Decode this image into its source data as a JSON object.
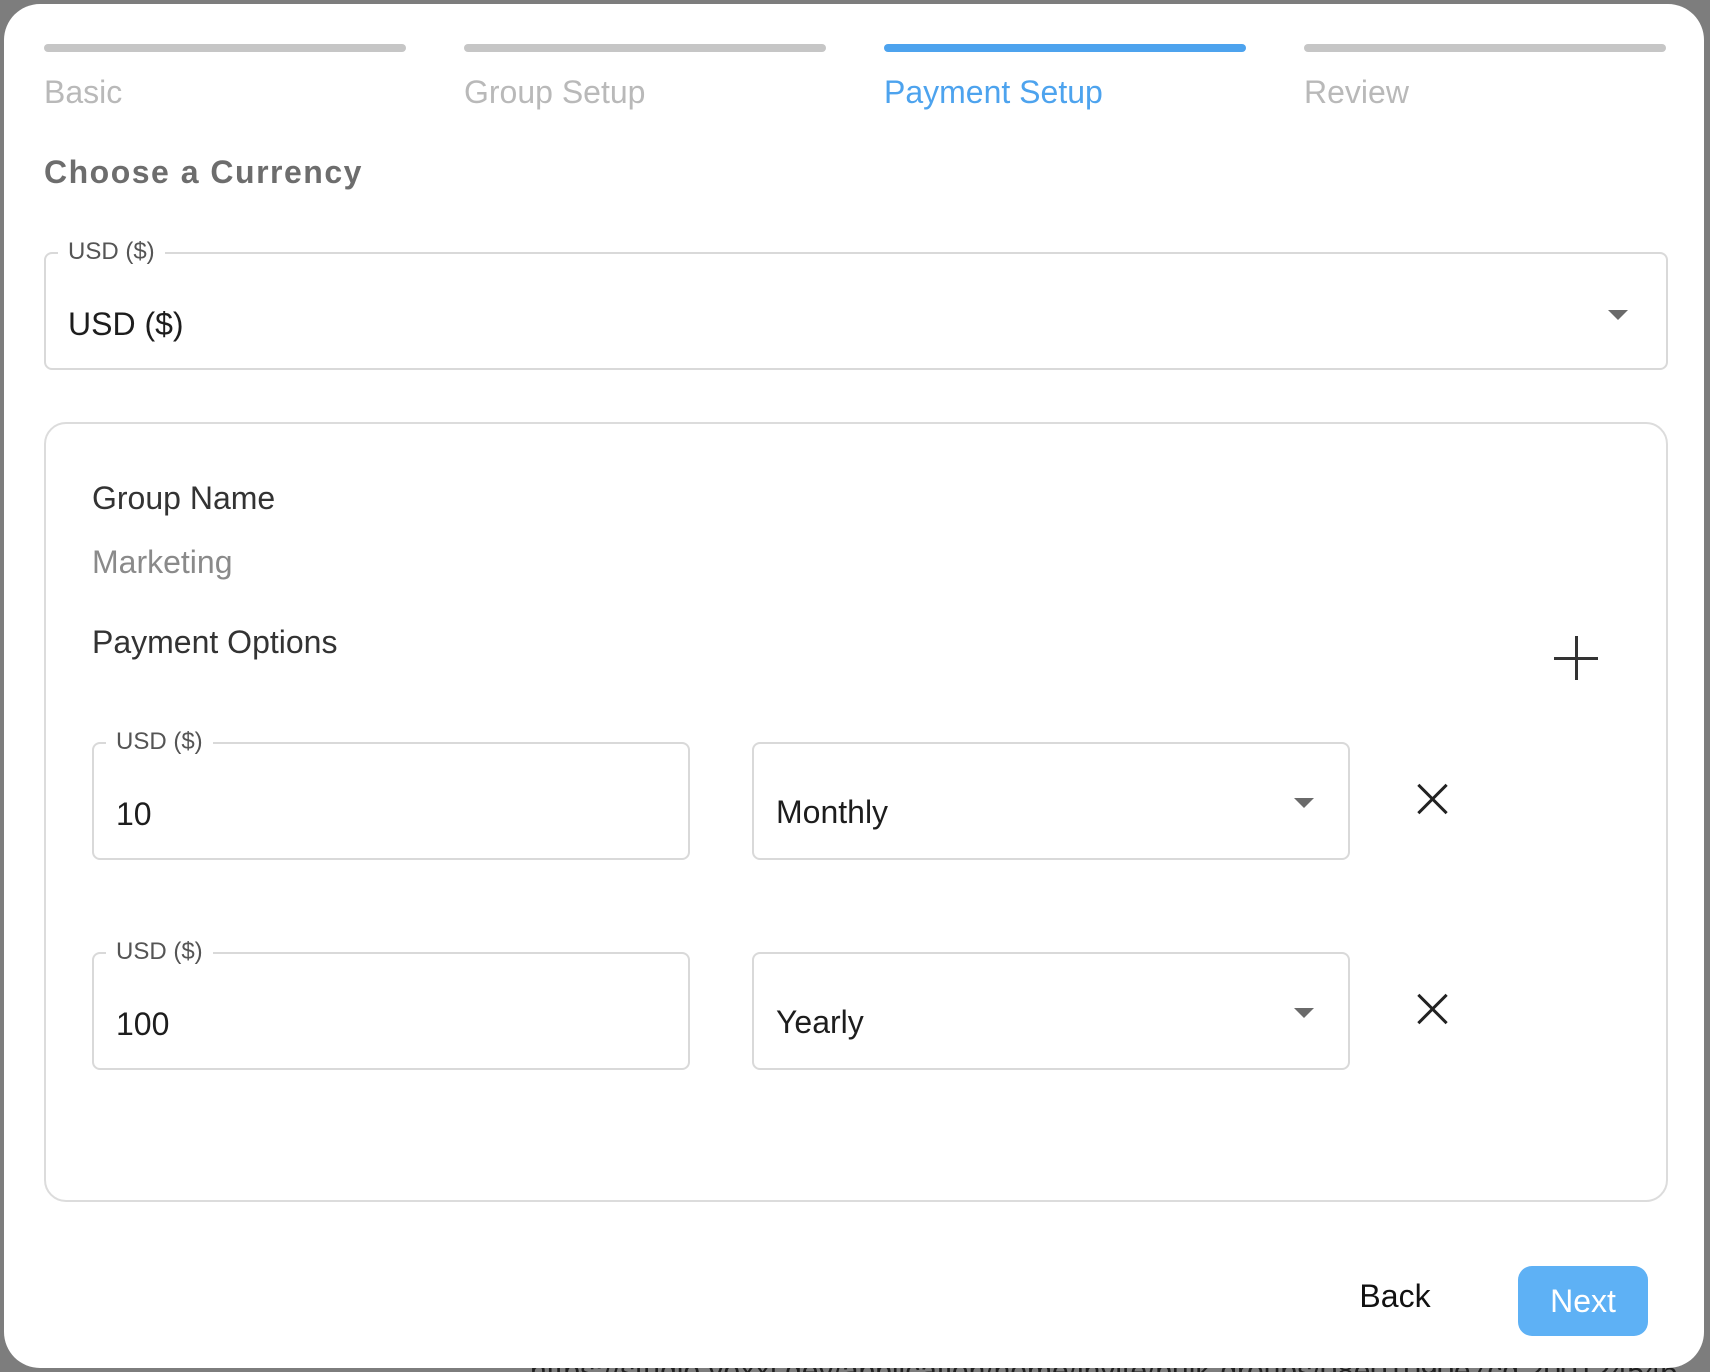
{
  "backdrop": {
    "url_fragment": "https://studio.voxxi.dev/application/home/invite/bulk-groups/08e01090e7cd 2001245462"
  },
  "stepper": {
    "steps": [
      {
        "label": "Basic",
        "active": false
      },
      {
        "label": "Group Setup",
        "active": false
      },
      {
        "label": "Payment Setup",
        "active": true
      },
      {
        "label": "Review",
        "active": false
      }
    ]
  },
  "currency": {
    "title": "Choose a Currency",
    "legend": "USD ($)",
    "selected": "USD ($)"
  },
  "group": {
    "name_label": "Group Name",
    "name_value": "Marketing",
    "payment_options_label": "Payment Options",
    "payment_options": [
      {
        "legend": "USD ($)",
        "amount": "10",
        "period": "Monthly"
      },
      {
        "legend": "USD ($)",
        "amount": "100",
        "period": "Yearly"
      }
    ]
  },
  "footer": {
    "back_label": "Back",
    "next_label": "Next"
  },
  "colors": {
    "accent": "#4da3ee",
    "next_button": "#5eb1f5",
    "inactive_step": "#c6c6c6"
  },
  "icons": {
    "add": "plus-icon",
    "remove": "close-icon",
    "dropdown": "caret-down-icon"
  }
}
